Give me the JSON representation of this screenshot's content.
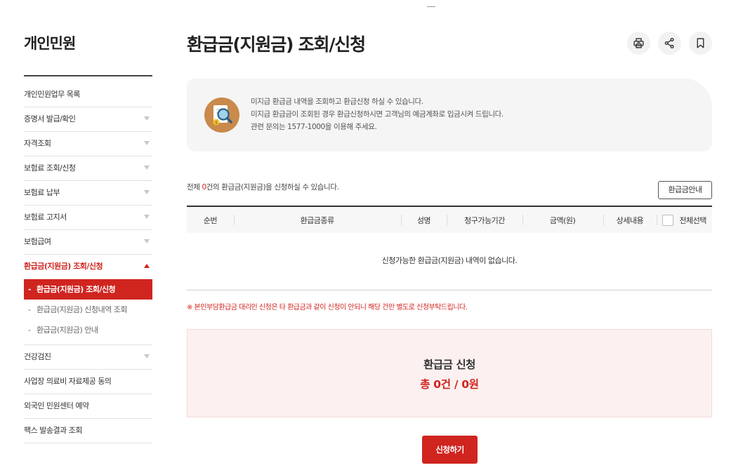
{
  "sidebar": {
    "title": "개인민원",
    "items": [
      {
        "label": "개인민원업무 목록",
        "arrow": false
      },
      {
        "label": "증명서 발급/확인",
        "arrow": true
      },
      {
        "label": "자격조회",
        "arrow": true
      },
      {
        "label": "보험료 조회/신청",
        "arrow": true
      },
      {
        "label": "보험료 납부",
        "arrow": true
      },
      {
        "label": "보험료 고지서",
        "arrow": true
      },
      {
        "label": "보험급여",
        "arrow": true
      },
      {
        "label": "환급금(지원금) 조회/신청",
        "arrow": true,
        "active": true
      },
      {
        "label": "건강검진",
        "arrow": true
      },
      {
        "label": "사업장 의료비 자료제공 동의",
        "arrow": false
      },
      {
        "label": "외국인 민원센터 예약",
        "arrow": false
      },
      {
        "label": "팩스 발송결과 조회",
        "arrow": false
      }
    ],
    "submenu": [
      {
        "label": "환급금(지원금) 조회/신청",
        "active": true
      },
      {
        "label": "환급금(지원금) 신청내역 조회",
        "active": false
      },
      {
        "label": "환급금(지원금) 안내",
        "active": false
      }
    ]
  },
  "header": {
    "title": "환급금(지원금) 조회/신청",
    "tools": [
      "print-icon",
      "share-icon",
      "bookmark-icon"
    ]
  },
  "info": {
    "icon": "magnifier-document-icon",
    "lines": [
      "미지급 환급금 내역을 조회하고 환급신청 하실 수 있습니다.",
      "미지급 환급금이 조회된 경우 환급신청하시면 고객님의 예금계좌로 입금시켜 드립니다.",
      "관련 문의는 1577-1000을 이용해 주세요."
    ]
  },
  "count": {
    "prefix": "전체 ",
    "num": "0",
    "suffix": "건의 환급금(지원금)을 신청하실 수 있습니다."
  },
  "guide_button": "환급금안내",
  "table": {
    "headers": [
      "순번",
      "환급금종류",
      "성명",
      "청구가능기간",
      "금액(원)",
      "상세내용",
      "전체선택"
    ],
    "empty_message": "신청가능한 환급금(지원금) 내역이 없습니다."
  },
  "notice": "※ 본인부담환급금 대리인 신청은 타 환급금과 같이 신청이 안되니 해당 건만 별도로 신청부탁드립니다.",
  "summary": {
    "title": "환급금 신청",
    "total": "총 0건 / 0원"
  },
  "apply_button": "신청하기",
  "colors": {
    "accent": "#d0241f",
    "panel": "#f5f5f5",
    "summary_bg": "#fcf1f0"
  }
}
